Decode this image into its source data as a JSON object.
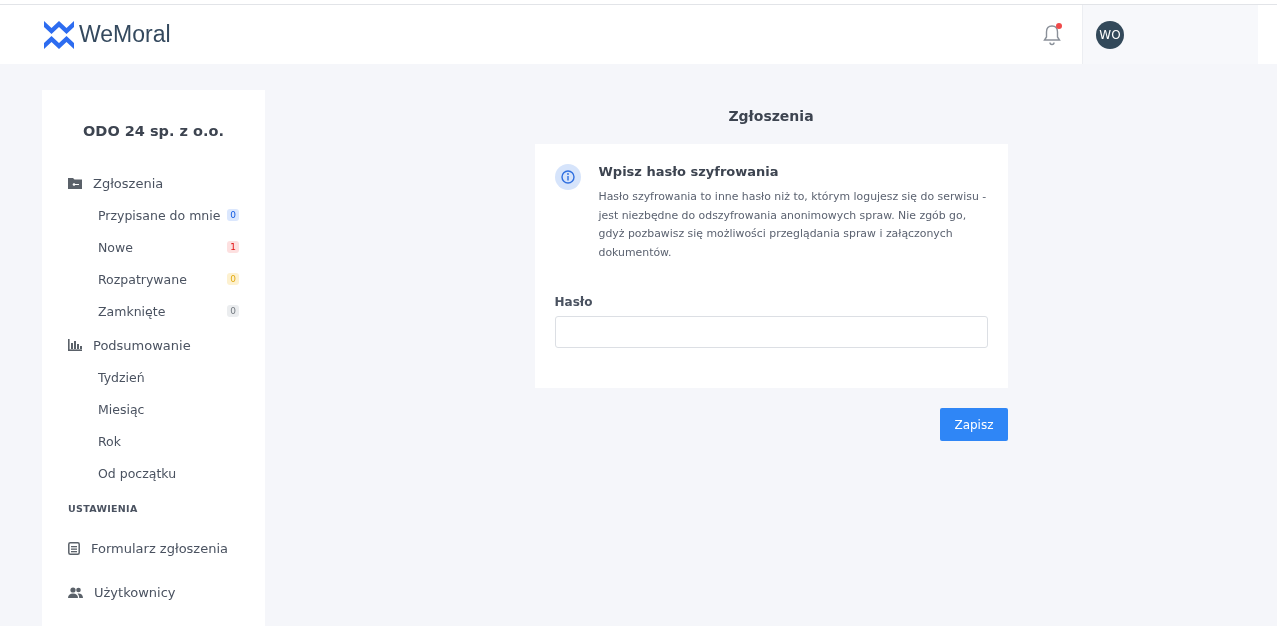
{
  "header": {
    "logo": "WeMoral",
    "notifications": {
      "unread": true
    },
    "avatar": "WO"
  },
  "sidebar": {
    "company": "ODO 24 sp. z o.o.",
    "nav": [
      {
        "kind": "group",
        "label": "Zgłoszenia",
        "children": [
          {
            "label": "Przypisane do mnie",
            "badge": "0",
            "color": "#dbe7fd"
          },
          {
            "label": "Nowe",
            "badge": "1",
            "color": "#fde0e0"
          },
          {
            "label": "Rozpatrywane",
            "badge": "0",
            "color": "#fdf1d0"
          },
          {
            "label": "Zamknięte",
            "badge": "0",
            "color": "#ebedef"
          }
        ]
      },
      {
        "kind": "group",
        "label": "Podsumowanie",
        "children": [
          {
            "label": "Tydzień"
          },
          {
            "label": "Miesiąc"
          },
          {
            "label": "Rok"
          },
          {
            "label": "Od początku"
          }
        ]
      },
      {
        "kind": "heading",
        "label": "USTAWIENIA"
      },
      {
        "kind": "group",
        "label": "Formularz zgłoszenia"
      },
      {
        "kind": "group",
        "label": "Użytkownicy"
      }
    ]
  },
  "main": {
    "title": "Zgłoszenia",
    "card": {
      "heading": "Wpisz hasło szyfrowania",
      "text": "Hasło szyfrowania to inne hasło niż to, którym logujesz się do serwisu - jest niezbędne do odszyfrowania anonimowych spraw. Nie zgób go, gdyż pozbawisz się możliwości przeglądania spraw i załączonych dokumentów.",
      "field_label": "Hasło"
    },
    "button": "Zapisz"
  }
}
